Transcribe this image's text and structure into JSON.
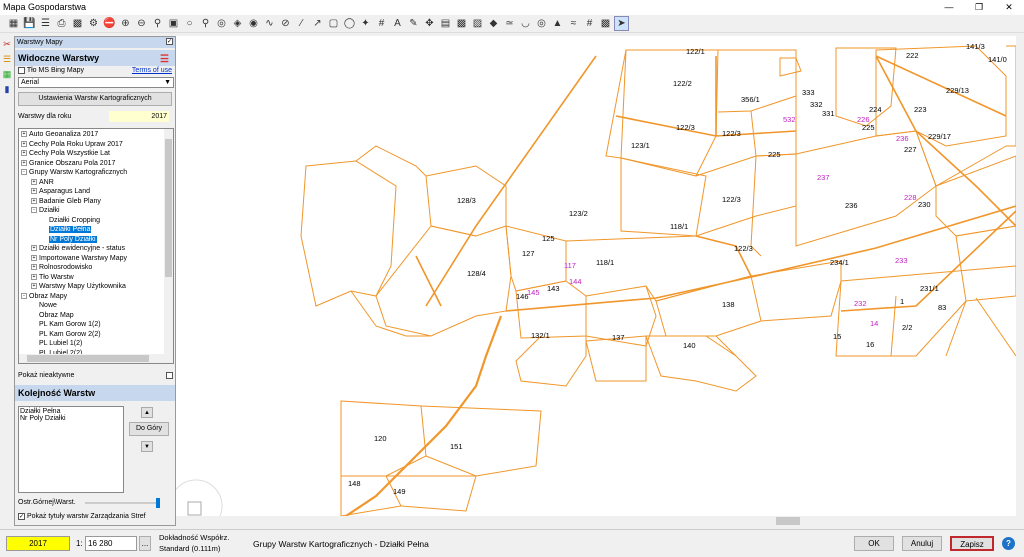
{
  "window": {
    "title": "Mapa Gospodarstwa"
  },
  "panel": {
    "header": "Warstwy Mapy",
    "visible_title": "Widoczne Warstwy",
    "bing_label": "Tło MS Bing Mapy",
    "terms_link": "Terms of use",
    "aerial_value": "Aerial",
    "settings_button": "Ustawienia Warstw Kartograficznych",
    "year_label": "Warstwy dla roku",
    "year_value": "2017",
    "inactive_label": "Pokaż nieaktywne",
    "order_title": "Kolejność Warstw",
    "order_items": [
      "Działki Pełna",
      "Nr Poly Działki"
    ],
    "up_button": "Do Góry",
    "transparency_label": "Ostr.Górnej\\Warst.",
    "zones_label": "Pokaż tytuły warstw Zarządzania Stref"
  },
  "tree": [
    {
      "label": "Auto Geoanaliza 2017",
      "level": 0,
      "pm": "+"
    },
    {
      "label": "Cechy Pola Roku Upraw 2017",
      "level": 0,
      "pm": "+"
    },
    {
      "label": "Cechy Pola Wszystkie Lat",
      "level": 0,
      "pm": "+"
    },
    {
      "label": "Granice Obszaru Pola 2017",
      "level": 0,
      "pm": "+"
    },
    {
      "label": "Grupy Warstw Kartograficznych",
      "level": 0,
      "pm": "-"
    },
    {
      "label": "ANR",
      "level": 1,
      "pm": "+"
    },
    {
      "label": "Asparagus Land",
      "level": 1,
      "pm": "+"
    },
    {
      "label": "Badanie Gleb Plany",
      "level": 1,
      "pm": "+"
    },
    {
      "label": "Działki",
      "level": 1,
      "pm": "-"
    },
    {
      "label": "Działki Cropping",
      "level": 2,
      "pm": ""
    },
    {
      "label": "Działki Pełna",
      "level": 2,
      "pm": "",
      "hl": true
    },
    {
      "label": "Nr Poly Działki",
      "level": 2,
      "pm": "",
      "hl": true
    },
    {
      "label": "Działki ewidencyjne - status",
      "level": 1,
      "pm": "+"
    },
    {
      "label": "Importowane Warstwy Mapy",
      "level": 1,
      "pm": "+"
    },
    {
      "label": "Rolnosrodowisko",
      "level": 1,
      "pm": "+"
    },
    {
      "label": "Tło Warstw",
      "level": 1,
      "pm": "+"
    },
    {
      "label": "Warstwy Mapy Użytkownika",
      "level": 1,
      "pm": "+"
    },
    {
      "label": "Obraz Mapy",
      "level": 0,
      "pm": "-"
    },
    {
      "label": "Nowe",
      "level": 1,
      "pm": ""
    },
    {
      "label": "Obraz Map",
      "level": 1,
      "pm": ""
    },
    {
      "label": "PL Kam Gorow 1(2)",
      "level": 1,
      "pm": ""
    },
    {
      "label": "PL Kam Gorow 2(2)",
      "level": 1,
      "pm": ""
    },
    {
      "label": "PL Lubiel 1(2)",
      "level": 1,
      "pm": ""
    },
    {
      "label": "PL Lubiel 2(2)",
      "level": 1,
      "pm": ""
    }
  ],
  "map": {
    "parcel_labels": [
      {
        "t": "122/1",
        "c": "#000"
      },
      {
        "t": "222",
        "c": "#000"
      },
      {
        "t": "141/3",
        "c": "#000"
      },
      {
        "t": "141/0",
        "c": "#000"
      },
      {
        "t": "122/2",
        "c": "#000"
      },
      {
        "t": "229/13",
        "c": "#000"
      },
      {
        "t": "333",
        "c": "#000"
      },
      {
        "t": "356/1",
        "c": "#000"
      },
      {
        "t": "332",
        "c": "#000"
      },
      {
        "t": "331",
        "c": "#000"
      },
      {
        "t": "224",
        "c": "#000"
      },
      {
        "t": "223",
        "c": "#000"
      },
      {
        "t": "532",
        "c": "#c020c0"
      },
      {
        "t": "226",
        "c": "#c020c0"
      },
      {
        "t": "122/3",
        "c": "#000"
      },
      {
        "t": "122/3",
        "c": "#000"
      },
      {
        "t": "225",
        "c": "#000"
      },
      {
        "t": "229/17",
        "c": "#000"
      },
      {
        "t": "236",
        "c": "#c020c0"
      },
      {
        "t": "227",
        "c": "#000"
      },
      {
        "t": "123/1",
        "c": "#000"
      },
      {
        "t": "225",
        "c": "#000"
      },
      {
        "t": "237",
        "c": "#c020c0"
      },
      {
        "t": "128/3",
        "c": "#000"
      },
      {
        "t": "122/3",
        "c": "#000"
      },
      {
        "t": "236",
        "c": "#000"
      },
      {
        "t": "228",
        "c": "#c020c0"
      },
      {
        "t": "230",
        "c": "#000"
      },
      {
        "t": "123/2",
        "c": "#000"
      },
      {
        "t": "118/1",
        "c": "#000"
      },
      {
        "t": "125",
        "c": "#000"
      },
      {
        "t": "122/3",
        "c": "#000"
      },
      {
        "t": "127",
        "c": "#000"
      },
      {
        "t": "117",
        "c": "#c020c0"
      },
      {
        "t": "118/1",
        "c": "#000"
      },
      {
        "t": "234/1",
        "c": "#000"
      },
      {
        "t": "233",
        "c": "#c020c0"
      },
      {
        "t": "128/4",
        "c": "#000"
      },
      {
        "t": "144",
        "c": "#c020c0"
      },
      {
        "t": "145",
        "c": "#c020c0"
      },
      {
        "t": "143",
        "c": "#000"
      },
      {
        "t": "146",
        "c": "#000"
      },
      {
        "t": "231/1",
        "c": "#000"
      },
      {
        "t": "138",
        "c": "#000"
      },
      {
        "t": "232",
        "c": "#c020c0"
      },
      {
        "t": "1",
        "c": "#000"
      },
      {
        "t": "83",
        "c": "#000"
      },
      {
        "t": "14",
        "c": "#c020c0"
      },
      {
        "t": "2/2",
        "c": "#000"
      },
      {
        "t": "132/1",
        "c": "#000"
      },
      {
        "t": "137",
        "c": "#000"
      },
      {
        "t": "15",
        "c": "#000"
      },
      {
        "t": "16",
        "c": "#000"
      },
      {
        "t": "140",
        "c": "#000"
      },
      {
        "t": "120",
        "c": "#000"
      },
      {
        "t": "151",
        "c": "#000"
      },
      {
        "t": "148",
        "c": "#000"
      },
      {
        "t": "149",
        "c": "#000"
      }
    ]
  },
  "status": {
    "year": "2017",
    "scale_prefix": "1:",
    "scale_value": "16 280",
    "scale_button": "...",
    "coord_line1": "Dokładność Współrz.",
    "coord_line2": "Standard (0.111m)",
    "layer_text": "Grupy Warstw Kartograficznych - Działki Pełna",
    "ok": "OK",
    "cancel": "Anuluj",
    "save": "Zapisz",
    "help": "?"
  },
  "colors": {
    "parcel": "#f0962a",
    "panel_header": "#c7d8ee",
    "highlight": "#0078d7",
    "year_bg": "#ffff00",
    "save_border": "#c0282d"
  }
}
